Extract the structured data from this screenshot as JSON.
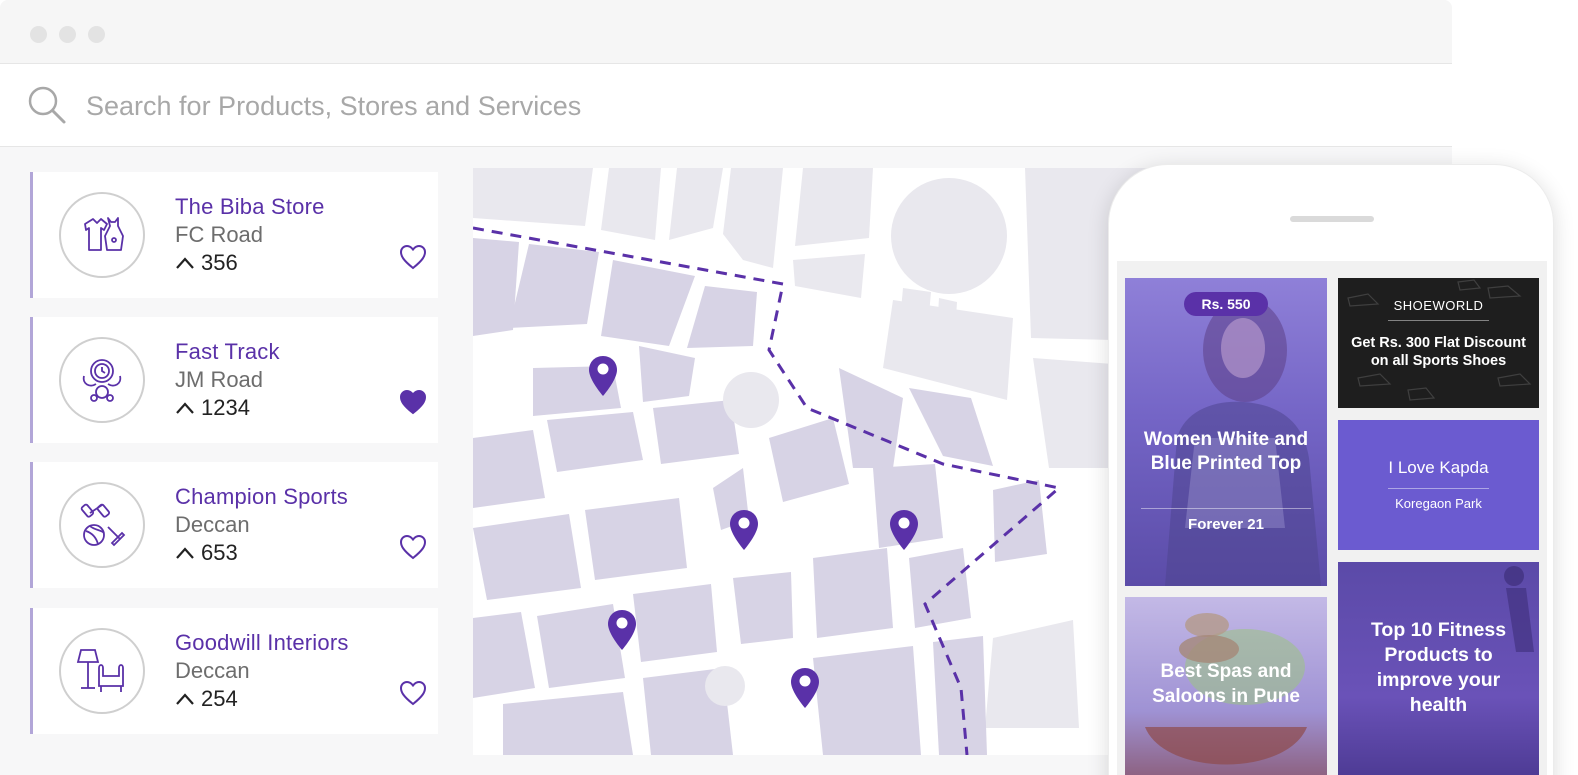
{
  "search": {
    "placeholder": "Search for Products, Stores and Services"
  },
  "stores": [
    {
      "name": "The Biba Store",
      "location": "FC Road",
      "votes": "356",
      "icon": "clothing-icon",
      "favorited": false
    },
    {
      "name": "Fast Track",
      "location": "JM Road",
      "votes": "1234",
      "icon": "watch-icon",
      "favorited": true
    },
    {
      "name": "Champion Sports",
      "location": "Deccan",
      "votes": "653",
      "icon": "sports-icon",
      "favorited": false
    },
    {
      "name": "Goodwill Interiors",
      "location": "Deccan",
      "votes": "254",
      "icon": "furniture-icon",
      "favorited": false
    }
  ],
  "phone": {
    "tile1": {
      "badge": "Rs. 550",
      "title": "Women White and Blue Printed Top",
      "brand": "Forever 21"
    },
    "tile2": {
      "brand": "SHOEWORLD",
      "title": "Get Rs. 300 Flat Discount on all Sports Shoes"
    },
    "tile3": {
      "title": "I Love Kapda",
      "location": "Koregaon Park"
    },
    "tile4": {
      "title": "Best Spas and Saloons in Pune"
    },
    "tile5": {
      "title": "Top 10 Fitness Products to improve your health"
    }
  },
  "colors": {
    "accent": "#5a31a8",
    "card_border": "#b2a6d8",
    "map_block": "#d8d4e6",
    "map_road": "#ffffff",
    "tile_purple": "#6b5bd0"
  }
}
